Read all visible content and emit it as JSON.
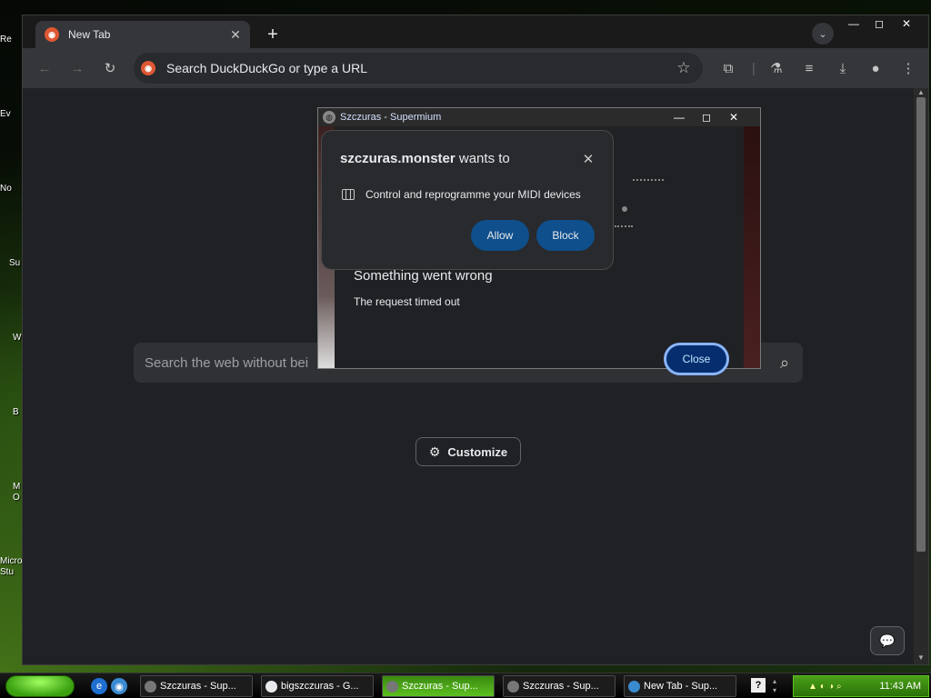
{
  "desktop": {
    "icons": [
      "Re",
      "Ev",
      "No",
      "Su",
      "W",
      "B",
      "M\nO",
      "Micro\nStu"
    ]
  },
  "browser": {
    "tab_title": "New Tab",
    "omnibox_text": "Search DuckDuckGo or type a URL",
    "search_placeholder": "Search the web without bei",
    "customize_label": "Customize"
  },
  "popup": {
    "title": "Szczuras - Supermium",
    "error_title": "Something went wrong",
    "error_message": "The request timed out",
    "close_label": "Close"
  },
  "permission": {
    "origin": "szczuras.monster",
    "suffix": " wants to",
    "description": "Control and reprogramme your MIDI devices",
    "allow_label": "Allow",
    "block_label": "Block"
  },
  "taskbar": {
    "tasks": [
      {
        "label": "Szczuras - Sup...",
        "active": false
      },
      {
        "label": "bigszczuras - G...",
        "active": false
      },
      {
        "label": "Szczuras - Sup...",
        "active": true
      },
      {
        "label": "Szczuras - Sup...",
        "active": false
      },
      {
        "label": "New Tab - Sup...",
        "active": false
      }
    ],
    "clock": "11:43 AM"
  },
  "colors": {
    "accent_blue": "#8ab4f8",
    "button_blue": "#0e4f8c",
    "ddg_orange": "#de5833",
    "start_green": "#3aa010"
  }
}
